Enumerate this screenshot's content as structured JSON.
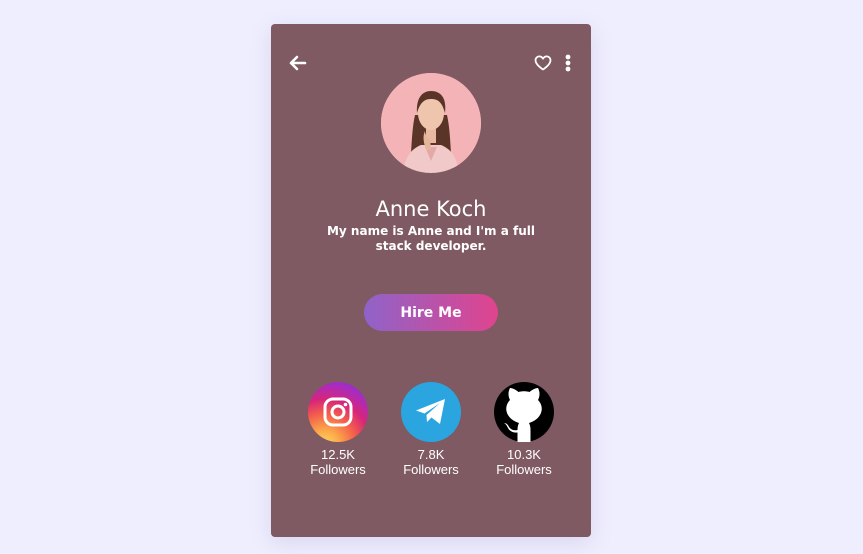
{
  "profile": {
    "name": "Anne Koch",
    "bio": "My name is Anne and I'm a full stack developer."
  },
  "actions": {
    "hire_label": "Hire Me"
  },
  "icons": {
    "back": "arrow-left-icon",
    "favorite": "heart-outline-icon",
    "more": "more-vertical-icon"
  },
  "socials": [
    {
      "platform": "Instagram",
      "icon": "instagram-icon",
      "count": "12.5K",
      "label": "Followers"
    },
    {
      "platform": "Telegram",
      "icon": "telegram-icon",
      "count": "7.8K",
      "label": "Followers"
    },
    {
      "platform": "GitHub",
      "icon": "github-icon",
      "count": "10.3K",
      "label": "Followers"
    }
  ],
  "colors": {
    "page_background": "#efeefe",
    "card_background": "#7f5a62",
    "button_gradient_start": "#8f63c9",
    "button_gradient_end": "#e0448e",
    "telegram_blue": "#2aa5e0",
    "github_black": "#000000"
  }
}
